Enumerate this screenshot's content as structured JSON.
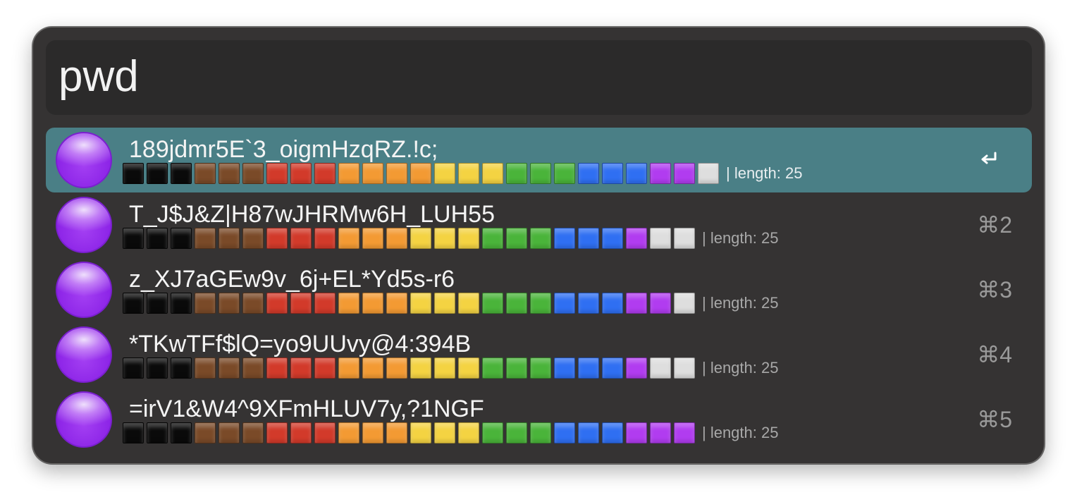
{
  "search": {
    "value": "pwd"
  },
  "palette": {
    "k": "#0a0a0a",
    "n": "#7a4a28",
    "r": "#d23a2a",
    "o": "#f39a33",
    "y": "#f4d342",
    "g": "#4ab43a",
    "b": "#2f6ff2",
    "p": "#b13cf0",
    "w": "#dedede"
  },
  "results": [
    {
      "password": "189jdmr5E`3_oigmHzqRZ.!c;",
      "strength": "kkknnnrrrooooyyyggg bbbppw",
      "length_label": "| length: 25",
      "shortcut": "",
      "shortcut_icon": "return-icon",
      "selected": true
    },
    {
      "password": "T_J$J&Z|H87wJHRMw6H_LUH55",
      "strength": "kkknnnrrroooyyygggbbbpww",
      "length_label": "| length: 25",
      "shortcut": "⌘2",
      "selected": false
    },
    {
      "password": "z_XJ7aGEw9v_6j+EL*Yd5s-r6",
      "strength": "kkknnnrrroooyyygggbbbppw",
      "length_label": "| length: 25",
      "shortcut": "⌘3",
      "selected": false
    },
    {
      "password": "*TKwTFf$lQ=yo9UUvy@4:394B",
      "strength": "kkknnnrrroooyyygggbbbpww",
      "length_label": "| length: 25",
      "shortcut": "⌘4",
      "selected": false
    },
    {
      "password": "=irV1&W4^9XFmHLUV7y,?1NGF",
      "strength": "kkknnnrrroooyyygggbbbppp",
      "length_label": "| length: 25",
      "shortcut": "⌘5",
      "selected": false
    }
  ]
}
